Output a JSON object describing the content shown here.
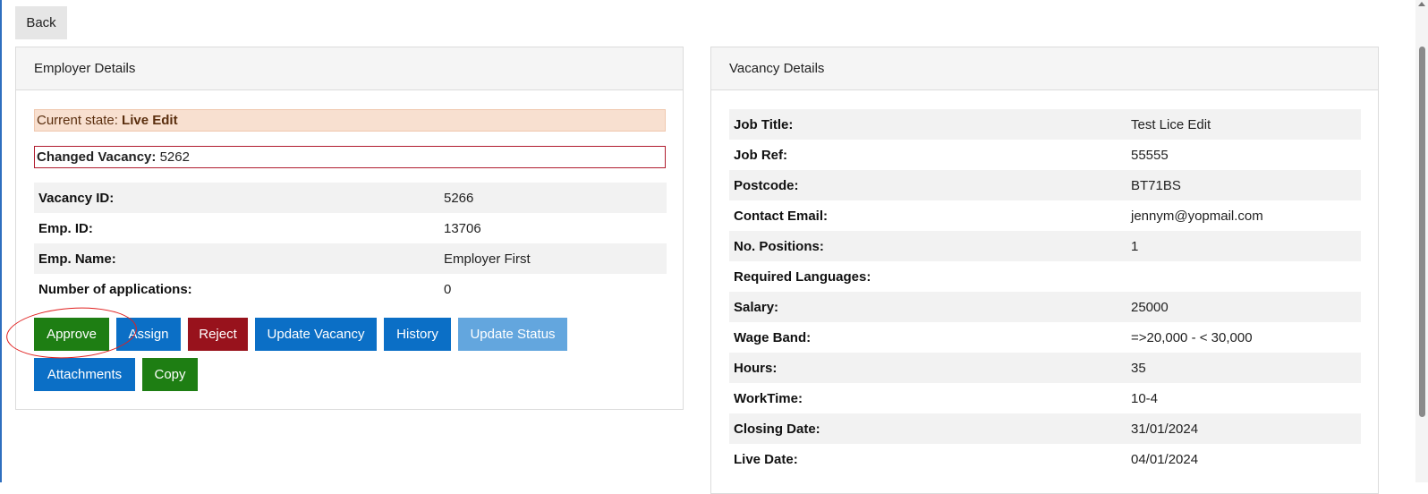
{
  "toolbar": {
    "back_label": "Back"
  },
  "employer_panel": {
    "title": "Employer Details",
    "state_label": "Current state:",
    "state_value": "Live Edit",
    "changed_label": "Changed Vacancy:",
    "changed_value": "5262",
    "rows": [
      {
        "label": "Vacancy ID:",
        "value": "5266"
      },
      {
        "label": "Emp. ID:",
        "value": "13706"
      },
      {
        "label": "Emp. Name:",
        "value": "Employer First"
      },
      {
        "label": "Number of applications:",
        "value": "0"
      }
    ],
    "buttons": {
      "approve": "Approve",
      "assign": "Assign",
      "reject": "Reject",
      "update_vacancy": "Update Vacancy",
      "history": "History",
      "update_status": "Update Status",
      "attachments": "Attachments",
      "copy": "Copy"
    }
  },
  "vacancy_panel": {
    "title": "Vacancy Details",
    "rows": [
      {
        "label": "Job Title:",
        "value": "Test Lice Edit"
      },
      {
        "label": "Job Ref:",
        "value": "55555"
      },
      {
        "label": "Postcode:",
        "value": "BT71BS"
      },
      {
        "label": "Contact Email:",
        "value": "jennym@yopmail.com"
      },
      {
        "label": "No. Positions:",
        "value": "1"
      },
      {
        "label": "Required Languages:",
        "value": ""
      },
      {
        "label": "Salary:",
        "value": "25000"
      },
      {
        "label": "Wage Band:",
        "value": "=>20,000 - < 30,000"
      },
      {
        "label": "Hours:",
        "value": "35"
      },
      {
        "label": "WorkTime:",
        "value": "10-4"
      },
      {
        "label": "Closing Date:",
        "value": "31/01/2024"
      },
      {
        "label": "Live Date:",
        "value": "04/01/2024"
      }
    ]
  },
  "colors": {
    "approve": "#1e7e13",
    "primary": "#0b6fc6",
    "reject": "#98121c",
    "disabled": "#63a6de",
    "state_bg": "#f8e0d0",
    "changed_border": "#b01c2e",
    "annotation": "#e0201f"
  }
}
